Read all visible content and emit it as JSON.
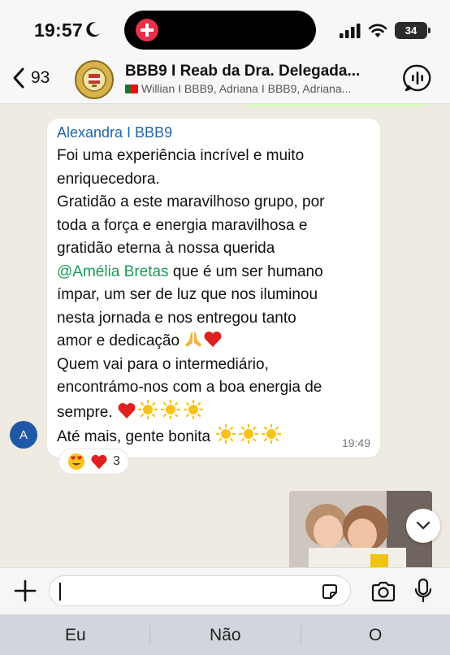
{
  "status_bar": {
    "time": "19:57",
    "battery": "34"
  },
  "header": {
    "back_count": "93",
    "group_name": "BBB9 I Reab da Dra. Delegada...",
    "members": "Willian I BBB9, Adriana I BBB9, Adriana..."
  },
  "message": {
    "sender": "Alexandra I BBB9",
    "lines": {
      "l1": "Foi uma experiência incrível e muito",
      "l2": "enriquecedora.",
      "l3": "Gratidão a este maravilhoso grupo, por",
      "l4": "toda a força e energia maravilhosa e",
      "l5": "gratidão eterna à nossa querida",
      "mention": "@Amélia Bretas",
      "l6_rest": " que é um ser humano",
      "l7": "ímpar, um ser de luz que nos iluminou",
      "l8": "nesta jornada e nos entregou tanto",
      "l9": "amor e dedicação",
      "l10": "Quem vai para o intermediário,",
      "l11": "encontrámo-nos com a boa energia de",
      "l12": "sempre.",
      "l13": "Até mais, gente bonita"
    },
    "time": "19:49",
    "avatar_initial": "A",
    "reaction_count": "3"
  },
  "keyboard": {
    "suggestions": [
      "Eu",
      "Não",
      "O"
    ]
  },
  "colors": {
    "sender": "#1f66a8",
    "mention": "#1a9a58",
    "chat_bg": "#efeae2",
    "avatar": "#1e58a7"
  },
  "icons": [
    "moon-icon",
    "signal-icon",
    "wifi-icon",
    "chevron-left-icon",
    "voice-chat-icon",
    "praying-hands-emoji",
    "heart-emoji",
    "sun-emoji",
    "heart-eyes-emoji",
    "chevron-down-icon",
    "plus-icon",
    "sticker-icon",
    "camera-icon",
    "microphone-icon"
  ]
}
